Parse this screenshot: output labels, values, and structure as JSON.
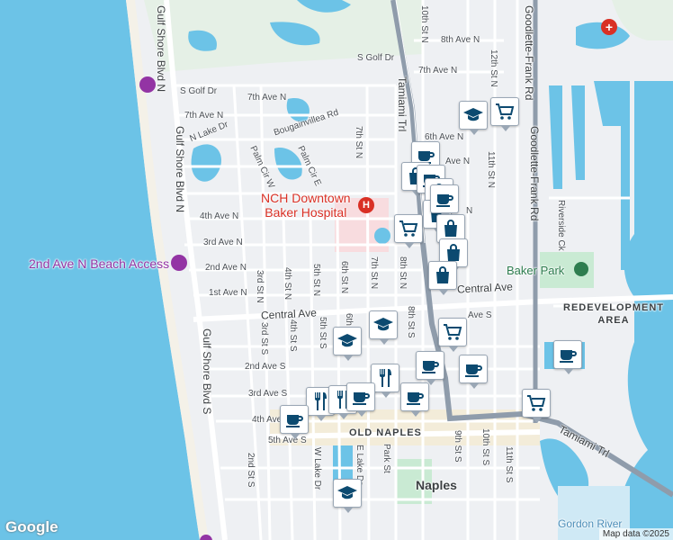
{
  "map": {
    "labels": {
      "hospital": "NCH Downtown\nBaker Hospital",
      "beach_access": "2nd Ave N Beach Access",
      "baker_park": "Baker Park",
      "redevelopment": "REDEVELOPMENT\nAREA",
      "old_naples": "OLD NAPLES",
      "naples": "Naples",
      "gordon_river": "Gordon River",
      "gulf_shore_1": "Gulf Shore Blvd N",
      "gulf_shore_2": "Gulf Shore Blvd N",
      "gulf_shore_s": "Gulf Shore Blvd S",
      "tamiami_n": "Tamiami Trl",
      "tamiami_s": "Tamiami Trl",
      "goodlette": "Goodlette-Frank Rd",
      "central_ave": "Central Ave",
      "central_ave_e": "Central Ave",
      "s_golf_dr": "S Golf Dr",
      "s_golf_dr2": "S Golf Dr",
      "n_lake_dr": "N Lake Dr",
      "bougainvillea": "Bougainvillea Rd",
      "palm_cir_w": "Palm Cir W",
      "palm_cir_e": "Palm Cir E",
      "riverside": "Riverside Ck",
      "ave_8n": "8th Ave N",
      "ave_7n_e": "7th Ave N",
      "ave_7n_w": "7th Ave N",
      "ave_7n_w2": "7th Ave N",
      "ave_6n": "6th Ave N",
      "ave_5n": "Ave N",
      "ave_4n": "4th Ave N",
      "ave_4n_e": "N",
      "ave_3n": "3rd Ave N",
      "ave_2n": "2nd Ave N",
      "ave_1n": "1st Ave N",
      "ave_1s": "Ave S",
      "ave_2s": "2nd Ave S",
      "ave_3s": "3rd Ave S",
      "ave_4s": "4th Ave",
      "ave_5s": "5th Ave S",
      "st_10n": "10th St N",
      "st_12n": "12th St N",
      "st_11n": "11th St N",
      "st_7n_a": "7th St N",
      "st_7n_b": "7th St N",
      "st_8n": "8th St N",
      "st_6n": "6th St N",
      "st_5n": "5th St N",
      "st_4n": "4th St N",
      "st_3n": "3rd St N",
      "st_3s": "3rd St S",
      "st_4s": "4th St S",
      "st_5s": "5th St S",
      "st_6s": "6th",
      "st_8s": "8th St S",
      "st_9s": "9th St S",
      "st_10s": "10th St S",
      "st_11s": "11th St S",
      "st_2s": "2nd St S",
      "w_lake": "W Lake Dr",
      "e_lake": "E Lake Dr",
      "park_st": "Park St"
    },
    "google_logo": "Google",
    "attribution": "Map data ©2025",
    "colors": {
      "water": "#6cc3e7",
      "land": "#eef0f3",
      "park": "#c9ead3",
      "hospital": "#f8dcdf",
      "road": "#ffffff",
      "highway": "#8f9cab",
      "pin_icon": "#0c4a70"
    },
    "markers": [
      {
        "icon": "school"
      },
      {
        "icon": "cart"
      },
      {
        "icon": "cafe"
      },
      {
        "icon": "bag"
      },
      {
        "icon": "cafe"
      },
      {
        "icon": "bag"
      },
      {
        "icon": "cart"
      },
      {
        "icon": "bag"
      },
      {
        "icon": "cafe"
      },
      {
        "icon": "bag"
      },
      {
        "icon": "bag"
      },
      {
        "icon": "bag"
      },
      {
        "icon": "school"
      },
      {
        "icon": "school"
      },
      {
        "icon": "cart"
      },
      {
        "icon": "restaurant"
      },
      {
        "icon": "cafe"
      },
      {
        "icon": "cafe"
      },
      {
        "icon": "cafe"
      },
      {
        "icon": "restaurant"
      },
      {
        "icon": "restaurant"
      },
      {
        "icon": "cafe"
      },
      {
        "icon": "cafe"
      },
      {
        "icon": "cart"
      },
      {
        "icon": "cafe"
      },
      {
        "icon": "school"
      }
    ]
  }
}
